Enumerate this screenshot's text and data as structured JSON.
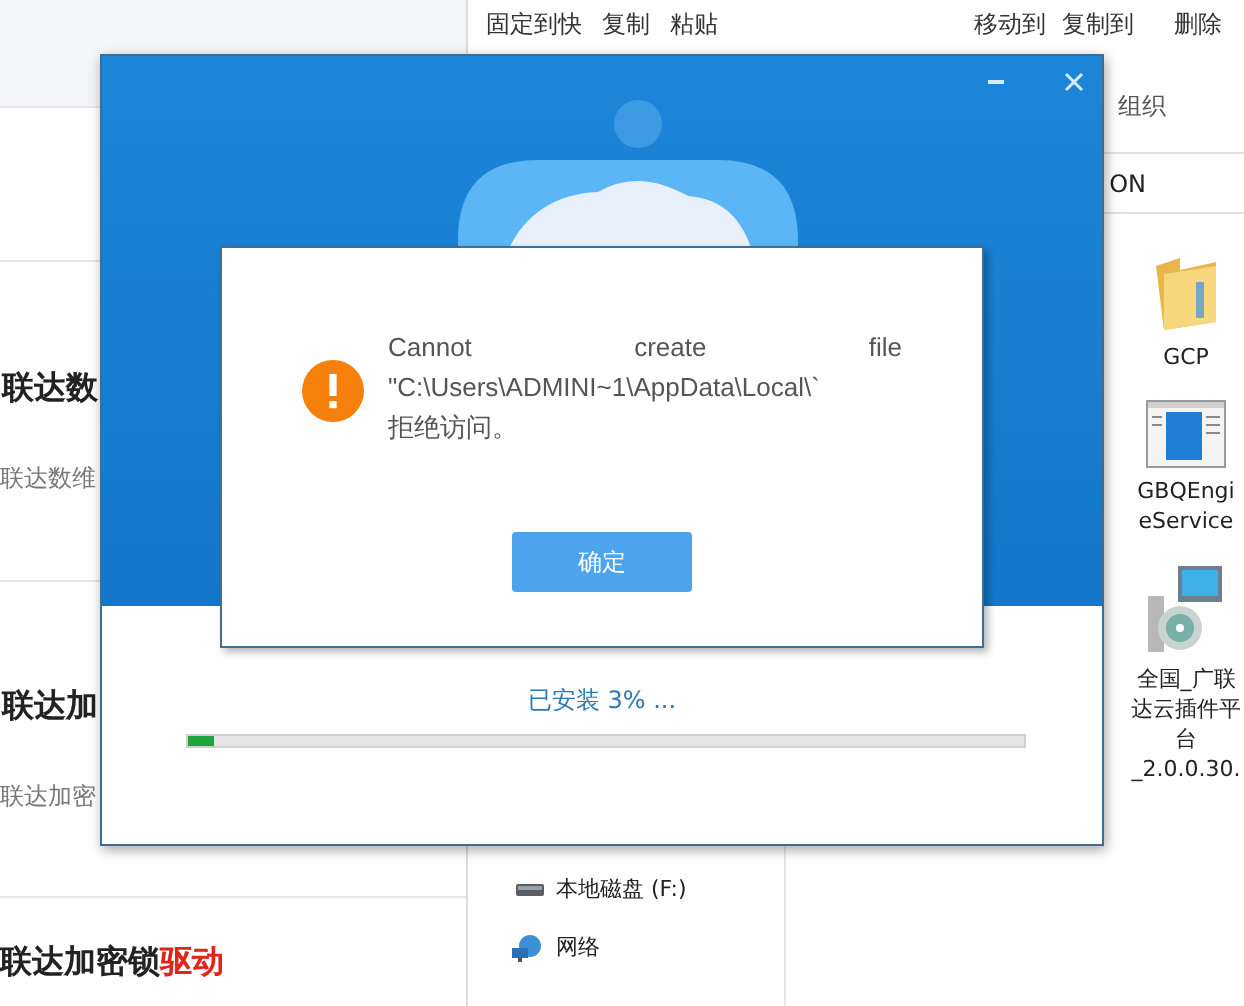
{
  "web_page": {
    "sections": [
      {
        "heading": "联达数",
        "subtitle": "联达数维"
      },
      {
        "heading": "联达加",
        "subtitle": "联达加密"
      }
    ],
    "footer_heading": {
      "text": "联达加密锁",
      "highlight": "驱动"
    }
  },
  "explorer": {
    "ribbon_groups": [
      {
        "buttons": [
          "固定到快",
          "复制",
          "粘贴"
        ]
      },
      {
        "buttons": [
          "移动到",
          "复制到",
          "删除"
        ]
      }
    ],
    "group_label": "组织",
    "address": "ON",
    "files": [
      {
        "kind": "folder",
        "lines": [
          "GCP"
        ]
      },
      {
        "kind": "app",
        "lines": [
          "GBQEngi",
          "eService"
        ]
      },
      {
        "kind": "installer",
        "lines": [
          "全国_广联",
          "达云插件平",
          "台",
          "_2.0.0.30."
        ]
      }
    ],
    "nav_items": [
      {
        "kind": "drive",
        "label": "本地磁盘 (F:)"
      },
      {
        "kind": "network",
        "label": "网络"
      }
    ]
  },
  "installer": {
    "status": "已安装 3% ...",
    "progress": {
      "level": 0.03
    },
    "dialog": {
      "message": "Cannot create file \"C:\\Users\\ADMINI~1\\AppData\\Local\\`\n拒绝访问。",
      "button": "确定"
    }
  }
}
